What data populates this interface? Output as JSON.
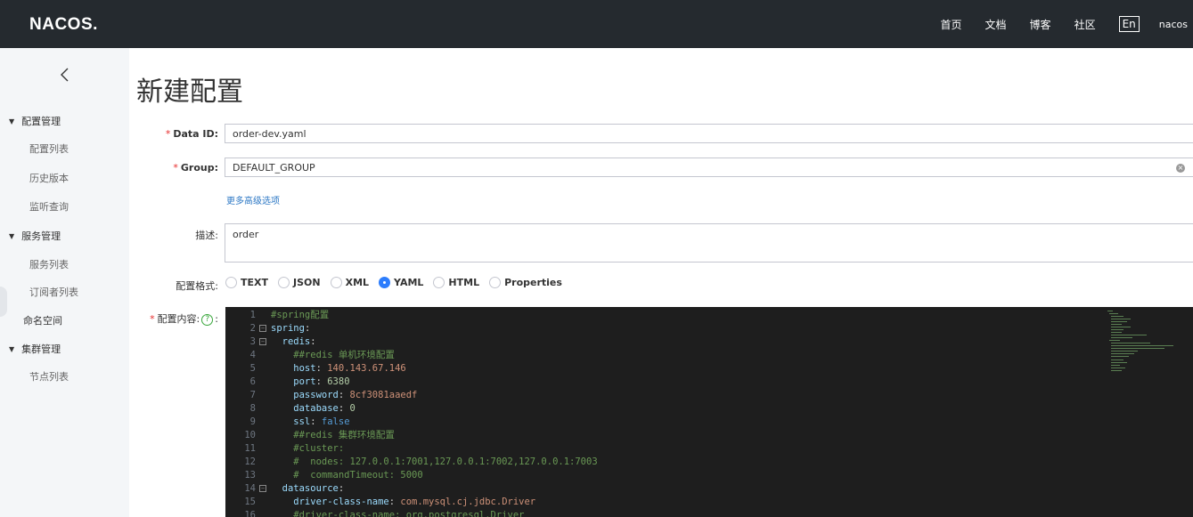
{
  "header": {
    "logo": "NACOS.",
    "nav": [
      "首页",
      "文档",
      "博客",
      "社区"
    ],
    "lang": "En",
    "user": "nacos"
  },
  "sidebar": {
    "groups": [
      {
        "label": "配置管理",
        "items": [
          "配置列表",
          "历史版本",
          "监听查询"
        ]
      },
      {
        "label": "服务管理",
        "items": [
          "服务列表",
          "订阅者列表"
        ]
      },
      {
        "single": "命名空间"
      },
      {
        "label": "集群管理",
        "items": [
          "节点列表"
        ]
      }
    ]
  },
  "page": {
    "title": "新建配置"
  },
  "form": {
    "data_id_label": "Data ID:",
    "data_id_value": "order-dev.yaml",
    "group_label": "Group:",
    "group_value": "DEFAULT_GROUP",
    "advanced_link": "更多高级选项",
    "desc_label": "描述:",
    "desc_value": "order",
    "format_label": "配置格式:",
    "formats": [
      "TEXT",
      "JSON",
      "XML",
      "YAML",
      "HTML",
      "Properties"
    ],
    "selected_format": "YAML",
    "content_label": "配置内容:",
    "content_suffix": ":"
  },
  "editor": {
    "lines": [
      {
        "n": "1",
        "text": "#spring配置"
      },
      {
        "n": "2",
        "text": "spring:"
      },
      {
        "n": "3",
        "text": "  redis:"
      },
      {
        "n": "4",
        "text": "    ##redis 单机环境配置"
      },
      {
        "n": "5",
        "text": "    host: 140.143.67.146"
      },
      {
        "n": "6",
        "text": "    port: 6380"
      },
      {
        "n": "7",
        "text": "    password: 8cf3081aaedf"
      },
      {
        "n": "8",
        "text": "    database: 0"
      },
      {
        "n": "9",
        "text": "    ssl: false"
      },
      {
        "n": "10",
        "text": "    ##redis 集群环境配置"
      },
      {
        "n": "11",
        "text": "    #cluster:"
      },
      {
        "n": "12",
        "text": "    #  nodes: 127.0.0.1:7001,127.0.0.1:7002,127.0.0.1:7003"
      },
      {
        "n": "13",
        "text": "    #  commandTimeout: 5000"
      },
      {
        "n": "14",
        "text": "  datasource:"
      },
      {
        "n": "15",
        "text": "    driver-class-name: com.mysql.cj.jdbc.Driver"
      },
      {
        "n": "16",
        "text": "    #driver-class-name: org.postgresql.Driver"
      }
    ]
  },
  "colors": {
    "topbar": "#252a2f",
    "sidebar": "#f4f6f8",
    "link": "#2d78c5",
    "radio_checked": "#2d7dfc",
    "required": "#e72e2e",
    "editor_bg": "#1e1e1e"
  }
}
